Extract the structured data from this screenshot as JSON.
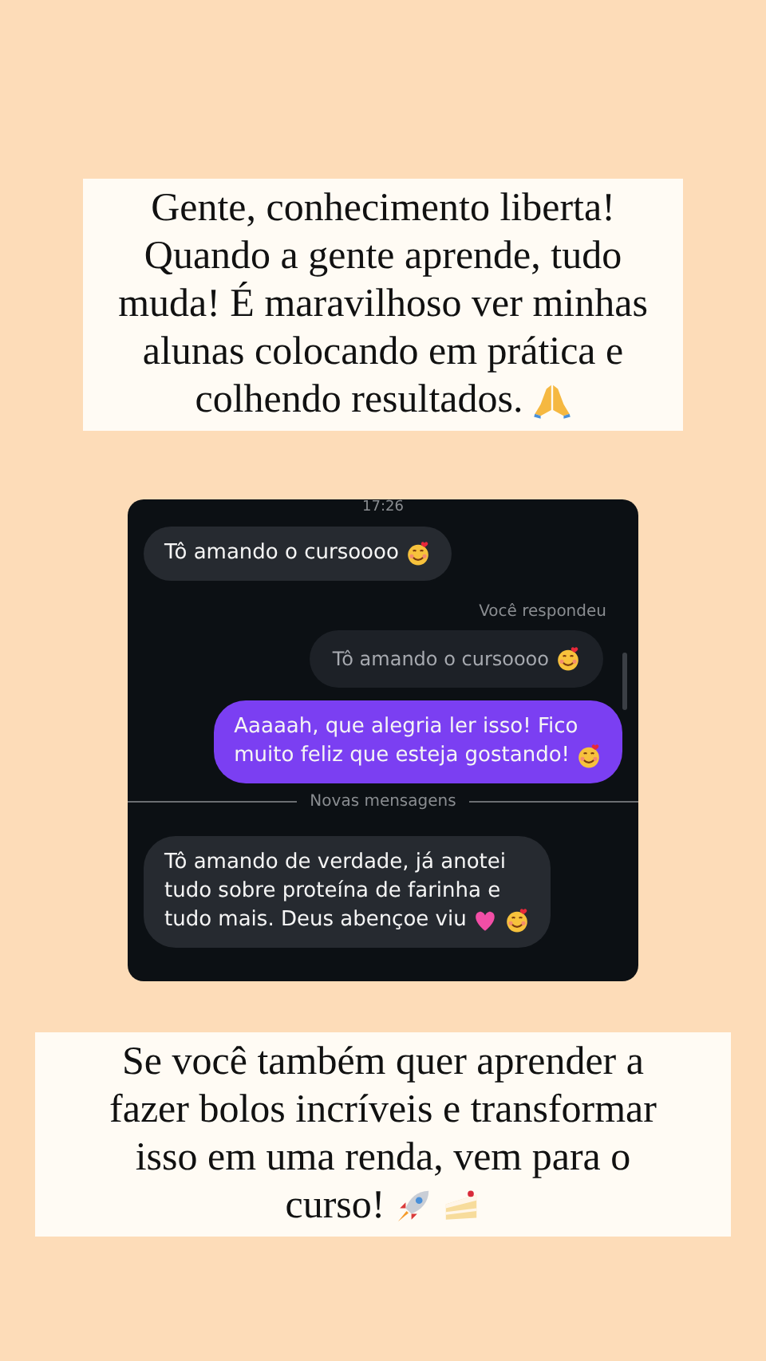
{
  "top_caption": {
    "lines": [
      "Gente, conhecimento liberta!",
      "Quando a gente aprende, tudo",
      "muda! É maravilhoso ver minhas",
      "alunas colocando em prática e",
      "colhendo resultados."
    ]
  },
  "chat": {
    "messages": [
      {
        "kind": "timestamp",
        "lines": [
          "17:26"
        ]
      },
      {
        "kind": "received",
        "lines": [
          "Tô amando o cursoooo"
        ]
      },
      {
        "kind": "label",
        "lines": [
          "Você respondeu"
        ]
      },
      {
        "kind": "quote",
        "lines": [
          "Tô amando o cursoooo"
        ]
      },
      {
        "kind": "sent",
        "lines": [
          "Aaaaah, que alegria ler isso! Fico",
          "muito feliz que esteja gostando!"
        ]
      },
      {
        "kind": "divider",
        "lines": [
          "Novas mensagens"
        ]
      },
      {
        "kind": "received",
        "lines": [
          "Tô amando de verdade, já anotei",
          "tudo sobre proteína de farinha e",
          "tudo mais. Deus abençoe viu"
        ]
      }
    ]
  },
  "bottom_caption": {
    "lines": [
      "Se você também quer aprender a",
      "fazer bolos incríveis e transformar",
      "isso em uma renda, vem para o",
      "curso!"
    ]
  }
}
